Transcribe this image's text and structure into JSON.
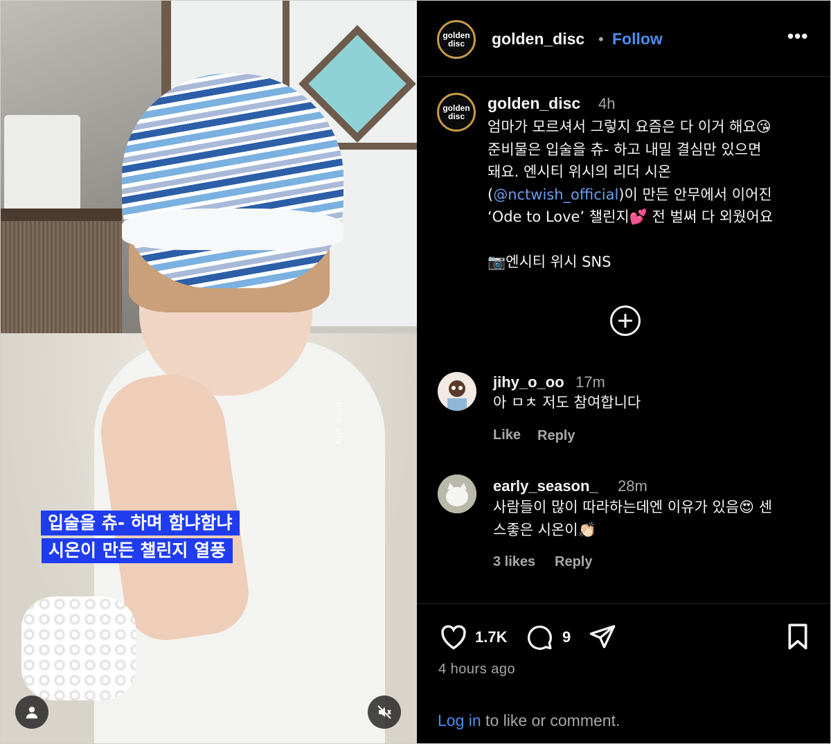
{
  "media": {
    "caption_line1": "입술을 츄- 하며 함냐함냐",
    "caption_line2": "시온이 만든 챌린지 열풍",
    "watermark": "NCT WISH"
  },
  "header": {
    "logo_line1": "golden",
    "logo_line2": "disc",
    "username": "golden_disc",
    "separator": "•",
    "follow_label": "Follow",
    "more_label": "•••"
  },
  "post": {
    "username": "golden_disc",
    "time": "4h",
    "caption_line1": "엄마가 모르셔서 그렇지 요즘은 다 이거 해요😘",
    "caption_line2": "준비물은 입술을 츄- 하고 내밀 결심만 있으면",
    "caption_line3": "돼요. 엔시티 위시의 리더 시온",
    "caption_mention_open": "(",
    "caption_mention": "@nctwish_official",
    "caption_line4_rest": ")이 만든 안무에서 이어진",
    "caption_line5": "‘Ode to Love’ 챌린지💕 전 벌써 다 외웠어요",
    "caption_line6": "📷엔시티 위시 SNS"
  },
  "comments": [
    {
      "username": "jihy_o_oo",
      "time": "17m",
      "text": "아 ㅁㅊ 저도 참여합니다",
      "like_label": "Like",
      "reply_label": "Reply"
    },
    {
      "username": "early_season_",
      "time": "28m",
      "text_line1": "사람들이 많이 따라하는데엔 이유가 있음😍 센",
      "text_line2": "스좋은 시온이👏🏻",
      "likes_label": "3 likes",
      "reply_label": "Reply"
    }
  ],
  "footer": {
    "like_count": "1.7K",
    "comment_count": "9",
    "time_ago": "4 hours ago",
    "login_link": "Log in",
    "login_rest": " to like or comment."
  },
  "colors": {
    "background": "#000000",
    "link_blue": "#4a8ff0",
    "mention_blue": "#6b9cf3",
    "muted_text": "#a8a8a8",
    "caption_box": "#1f3cf0"
  }
}
